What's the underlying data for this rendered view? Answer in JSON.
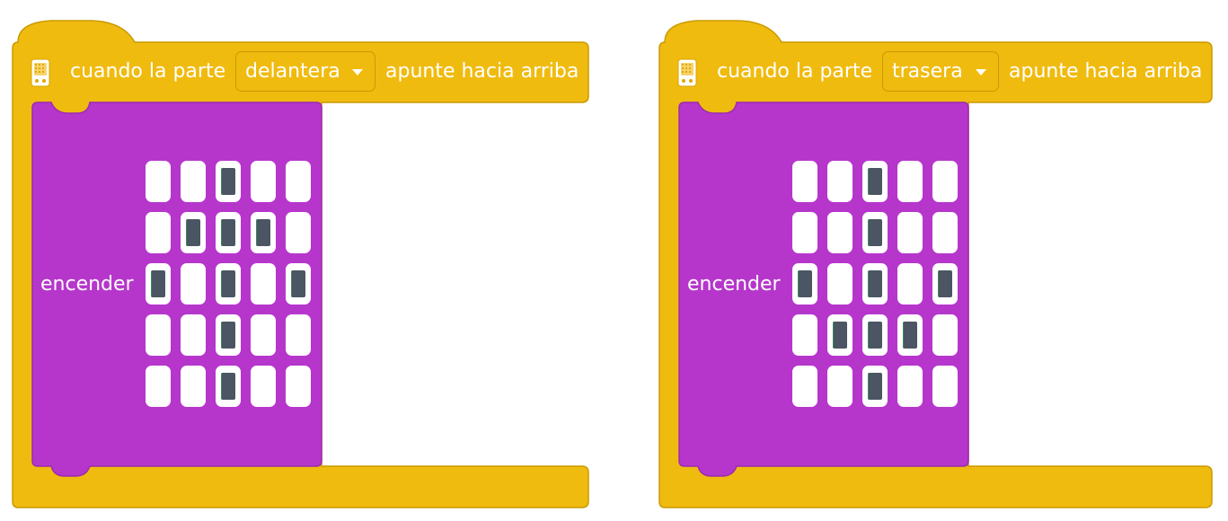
{
  "colors": {
    "event_block": "#f0bb0f",
    "led_block": "#b636cc",
    "led_on": "#4b5563",
    "led_off": "#ffffff"
  },
  "blocks": [
    {
      "icon": "microbit-icon",
      "prefix": "cuando la parte",
      "dropdown_value": "delantera",
      "suffix": "apunte hacia arriba",
      "action_label": "encender",
      "leds": [
        [
          0,
          0,
          1,
          0,
          0
        ],
        [
          0,
          1,
          1,
          1,
          0
        ],
        [
          1,
          0,
          1,
          0,
          1
        ],
        [
          0,
          0,
          1,
          0,
          0
        ],
        [
          0,
          0,
          1,
          0,
          0
        ]
      ]
    },
    {
      "icon": "microbit-icon",
      "prefix": "cuando la parte",
      "dropdown_value": "trasera",
      "suffix": "apunte hacia arriba",
      "action_label": "encender",
      "leds": [
        [
          0,
          0,
          1,
          0,
          0
        ],
        [
          0,
          0,
          1,
          0,
          0
        ],
        [
          1,
          0,
          1,
          0,
          1
        ],
        [
          0,
          1,
          1,
          1,
          0
        ],
        [
          0,
          0,
          1,
          0,
          0
        ]
      ]
    }
  ]
}
